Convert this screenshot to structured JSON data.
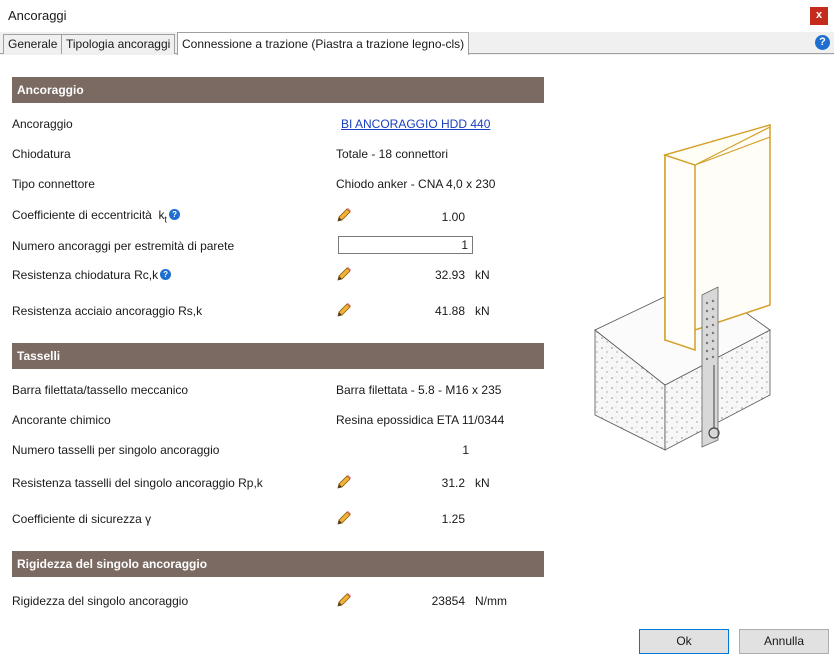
{
  "window": {
    "title": "Ancoraggi",
    "close_label": "x"
  },
  "tabs": [
    {
      "label": "Generale"
    },
    {
      "label": "Tipologia ancoraggi"
    },
    {
      "label": "Connessione a trazione (Piastra a trazione legno-cls)"
    }
  ],
  "help_label": "?",
  "sections": {
    "ancoraggio": {
      "header": "Ancoraggio",
      "ancoraggio_label": "Ancoraggio",
      "ancoraggio_value": "BI ANCORAGGIO HDD 440",
      "chiodatura_label": "Chiodatura",
      "chiodatura_value": "Totale - 18 connettori",
      "tipo_label": "Tipo connettore",
      "tipo_value": "Chiodo anker - CNA 4,0 x 230",
      "coeff_label": "Coefficiente di eccentricità",
      "coeff_symbol": "k",
      "coeff_sub": "t",
      "coeff_value": "1.00",
      "numero_label": "Numero ancoraggi per estremità di parete",
      "numero_value": "1",
      "rck_label": "Resistenza chiodatura Rc,k",
      "rck_value": "32.93",
      "rck_unit": "kN",
      "rsk_label": "Resistenza acciaio ancoraggio Rs,k",
      "rsk_value": "41.88",
      "rsk_unit": "kN"
    },
    "tasselli": {
      "header": "Tasselli",
      "barra_label": "Barra filettata/tassello meccanico",
      "barra_value": "Barra filettata - 5.8 - M16 x 235",
      "chimico_label": "Ancorante chimico",
      "chimico_value": "Resina epossidica ETA 11/0344",
      "numero_label": "Numero tasselli per singolo ancoraggio",
      "numero_value": "1",
      "rpk_label": "Resistenza tasselli del singolo ancoraggio Rp,k",
      "rpk_value": "31.2",
      "rpk_unit": "kN",
      "gamma_label": "Coefficiente di sicurezza γ",
      "gamma_value": "1.25"
    },
    "rigidezza": {
      "header": "Rigidezza del singolo ancoraggio",
      "label": "Rigidezza del singolo ancoraggio",
      "value": "23854",
      "unit": "N/mm"
    }
  },
  "buttons": {
    "ok": "Ok",
    "cancel": "Annulla"
  },
  "colors": {
    "section_header": "#7a6a62",
    "link": "#1a3fbf",
    "accent": "#0078d7",
    "timber_outline": "#d4a02a"
  }
}
